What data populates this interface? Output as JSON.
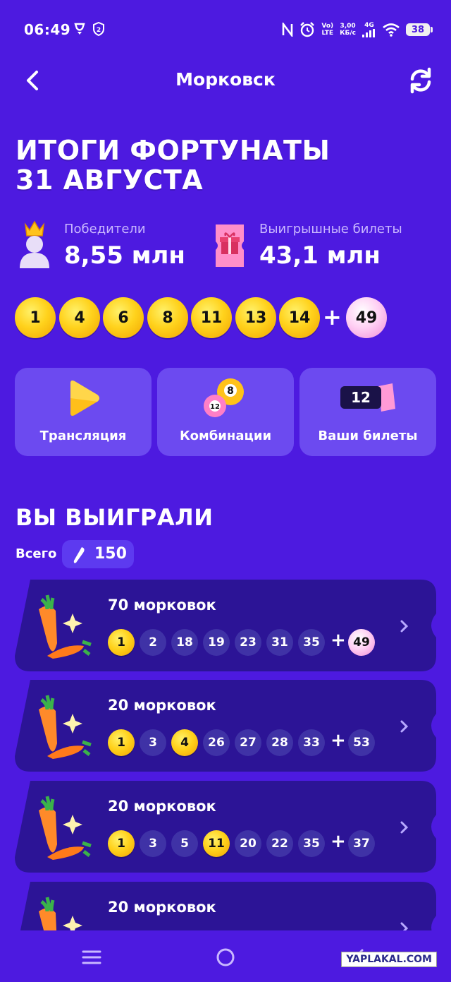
{
  "status_bar": {
    "time": "06:49",
    "net_speed_value": "3,00",
    "net_speed_unit": "КБ/с",
    "volte": "Vo)",
    "lte": "LTE",
    "signal_type": "4G",
    "battery": "38"
  },
  "header": {
    "title": "Морковск"
  },
  "results": {
    "title_line1": "ИТОГИ ФОРТУНАТЫ",
    "title_line2": "31 АВГУСТА"
  },
  "stats": {
    "winners_label": "Победители",
    "winners_value": "8,55 млн",
    "tickets_label": "Выигрышные билеты",
    "tickets_value": "43,1 млн"
  },
  "drawn_numbers": [
    "1",
    "4",
    "6",
    "8",
    "11",
    "13",
    "14"
  ],
  "bonus_number": "49",
  "actions": {
    "broadcast": "Трансляция",
    "combinations": "Комбинации",
    "your_tickets": "Ваши билеты",
    "your_tickets_count": "12",
    "combinations_ball_1": "8",
    "combinations_ball_2": "12"
  },
  "winnings": {
    "section_title": "ВЫ ВЫИГРАЛИ",
    "total_label": "Всего",
    "total_value": "150"
  },
  "tickets": [
    {
      "title": "70 морковок",
      "numbers": [
        "1",
        "2",
        "18",
        "19",
        "23",
        "31",
        "35"
      ],
      "matched": [
        true,
        false,
        false,
        false,
        false,
        false,
        false
      ],
      "bonus": "49",
      "bonus_matched": true
    },
    {
      "title": "20 морковок",
      "numbers": [
        "1",
        "3",
        "4",
        "26",
        "27",
        "28",
        "33"
      ],
      "matched": [
        true,
        false,
        true,
        false,
        false,
        false,
        false
      ],
      "bonus": "53",
      "bonus_matched": false
    },
    {
      "title": "20 морковок",
      "numbers": [
        "1",
        "3",
        "5",
        "11",
        "20",
        "22",
        "35"
      ],
      "matched": [
        true,
        false,
        false,
        true,
        false,
        false,
        false
      ],
      "bonus": "37",
      "bonus_matched": false
    },
    {
      "title": "20 морковок"
    }
  ],
  "watermark": "YAPLAKAL.COM",
  "colors": {
    "background": "#4d1ae0",
    "card": "#6c4af0",
    "ticket": "#2c1496",
    "ball_gold": "#ffd21c",
    "ball_pink": "#ffd1f4",
    "ball_gray": "#3f32a6"
  }
}
